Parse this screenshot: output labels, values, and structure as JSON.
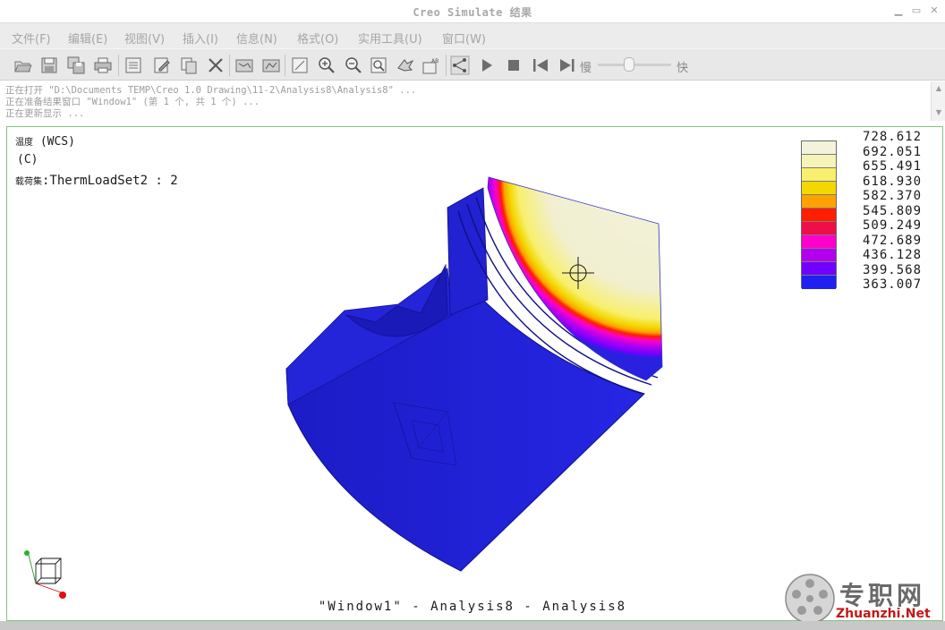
{
  "window": {
    "title": "Creo Simulate 结果"
  },
  "menu": {
    "file": "文件(F)",
    "edit": "编辑(E)",
    "view": "视图(V)",
    "insert": "插入(I)",
    "info": "信息(N)",
    "format": "格式(O)",
    "tools": "实用工具(U)",
    "window": "窗口(W)"
  },
  "toolbar": {
    "icons": [
      "open-icon",
      "save-icon",
      "save-copy-icon",
      "print-icon",
      "page-setup-icon",
      "edit-icon",
      "copy-icon",
      "delete-icon",
      "result-window-icon",
      "result-compare-icon",
      "frame-icon",
      "zoom-in-icon",
      "zoom-out-icon",
      "refit-icon",
      "spin-icon",
      "label-icon",
      "animate-path-icon",
      "play-icon",
      "stop-icon",
      "rewind-icon",
      "step-forward-icon"
    ],
    "speed_slow": "慢",
    "speed_fast": "快",
    "speed_level": 0.43
  },
  "messages": [
    "正在打开 \"D:\\Documents TEMP\\Creo 1.0 Drawing\\11-2\\Analysis8\\Analysis8\" ...",
    "正在准备结果窗口 \"Window1\" (第 1 个, 共 1 个) ...",
    "正在更新显示 ..."
  ],
  "viewport": {
    "quantity_label": "温度",
    "coord_system": "(WCS)",
    "unit": "(C)",
    "load_set_label": "载荷集",
    "load_set_value": ":ThermLoadSet2 :  2",
    "caption": "\"Window1\" - Analysis8 - Analysis8"
  },
  "legend": {
    "values": [
      "728.612",
      "692.051",
      "655.491",
      "618.930",
      "582.370",
      "545.809",
      "509.249",
      "472.689",
      "436.128",
      "399.568",
      "363.007"
    ],
    "colors": [
      "#f3f3dc",
      "#f6f3b8",
      "#f8ef6e",
      "#f2d800",
      "#ffa200",
      "#ff1e00",
      "#ef0f48",
      "#ff00cc",
      "#b200ef",
      "#7100ff",
      "#2020f0"
    ]
  },
  "watermark": {
    "brand": "专职网",
    "url": "Zhuanzhi.Net"
  },
  "colors": {
    "model_blue": "#2020d6",
    "viewport_border": "#86c286"
  }
}
